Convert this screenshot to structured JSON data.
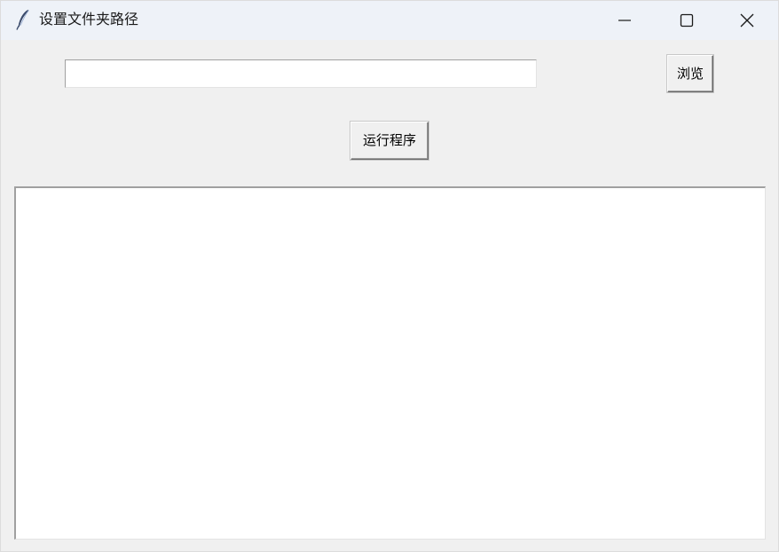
{
  "window": {
    "title": "设置文件夹路径"
  },
  "path": {
    "value": "",
    "placeholder": ""
  },
  "buttons": {
    "browse_label": "浏览",
    "run_label": "运行程序"
  },
  "output": {
    "text": ""
  },
  "icons": {
    "app": "feather-icon",
    "minimize": "minimize-icon",
    "maximize": "maximize-icon",
    "close": "close-icon"
  },
  "colors": {
    "titlebar": "#eef2f8",
    "window_bg": "#f0f0f0",
    "icon_feather": "#3a4a6b"
  }
}
